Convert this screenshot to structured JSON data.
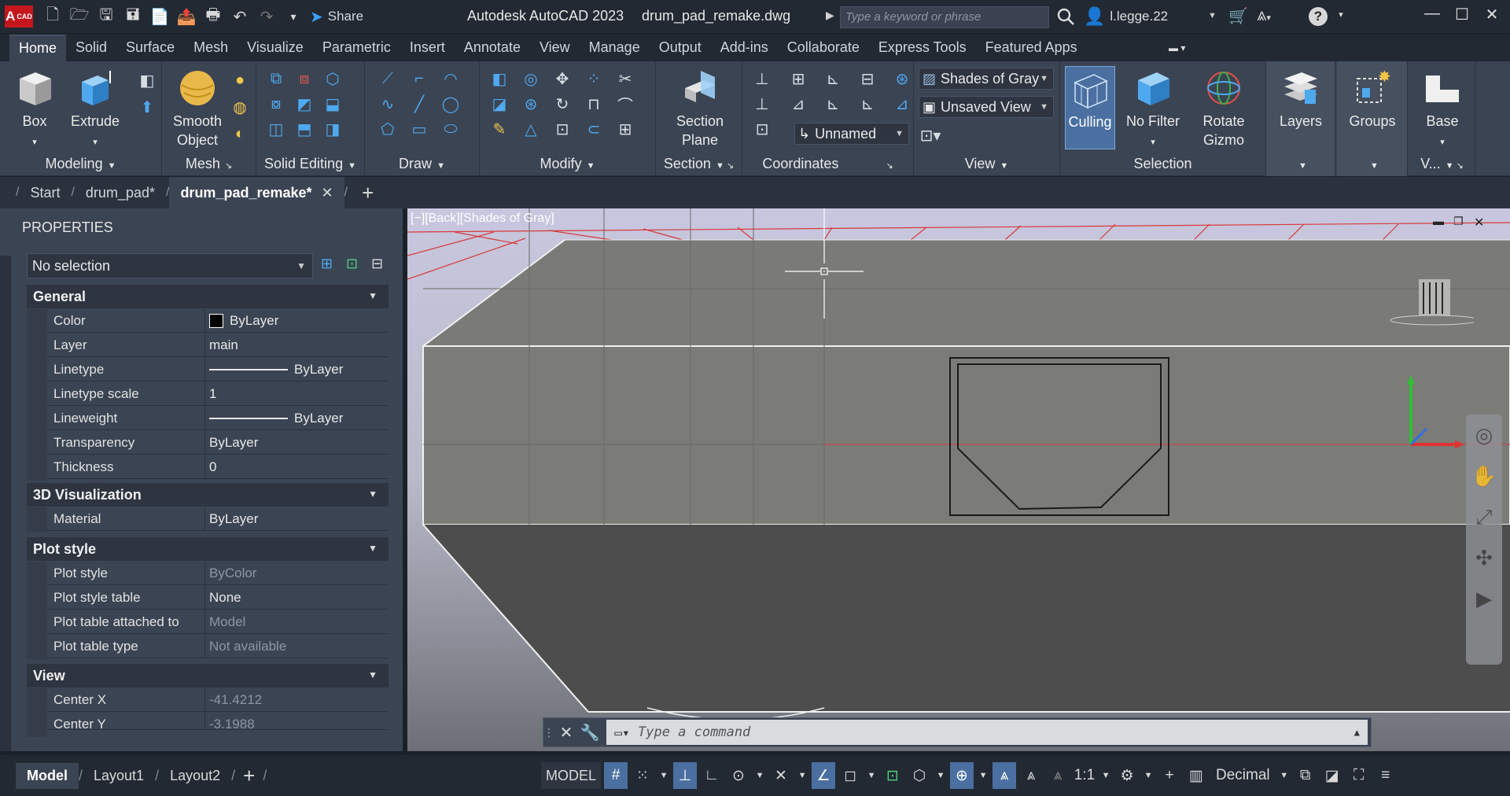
{
  "titlebar": {
    "app_logo": "A",
    "app_logo_sub": "CAD",
    "share_label": "Share",
    "app_title": "Autodesk AutoCAD 2023",
    "file_name": "drum_pad_remake.dwg",
    "search_placeholder": "Type a keyword or phrase",
    "user_name": "l.legge.22"
  },
  "ribbon_tabs": [
    "Home",
    "Solid",
    "Surface",
    "Mesh",
    "Visualize",
    "Parametric",
    "Insert",
    "Annotate",
    "View",
    "Manage",
    "Output",
    "Add-ins",
    "Collaborate",
    "Express Tools",
    "Featured Apps"
  ],
  "ribbon": {
    "modeling": {
      "label": "Modeling",
      "box": "Box",
      "extrude": "Extrude"
    },
    "mesh": {
      "label": "Mesh",
      "smooth_object_1": "Smooth",
      "smooth_object_2": "Object"
    },
    "solid_editing": {
      "label": "Solid Editing"
    },
    "draw": {
      "label": "Draw"
    },
    "modify": {
      "label": "Modify"
    },
    "section": {
      "label": "Section",
      "section_plane_1": "Section",
      "section_plane_2": "Plane"
    },
    "coordinates": {
      "label": "Coordinates",
      "ucs_name": "Unnamed"
    },
    "view": {
      "label": "View",
      "visual_style": "Shades of Gray",
      "saved_view": "Unsaved View"
    },
    "selection": {
      "label": "Selection",
      "culling": "Culling",
      "no_filter": "No Filter",
      "rotate_gizmo_1": "Rotate",
      "rotate_gizmo_2": "Gizmo"
    },
    "layers": {
      "label": "Layers"
    },
    "groups": {
      "label": "Groups"
    },
    "base": {
      "label": "Base",
      "group_label": "V..."
    }
  },
  "doc_tabs": {
    "start": "Start",
    "tab1": "drum_pad*",
    "tab2": "drum_pad_remake*"
  },
  "properties": {
    "title": "PROPERTIES",
    "selection": "No selection",
    "general": {
      "label": "General",
      "rows": [
        {
          "key": "Color",
          "value": "ByLayer"
        },
        {
          "key": "Layer",
          "value": "main"
        },
        {
          "key": "Linetype",
          "value": "ByLayer"
        },
        {
          "key": "Linetype scale",
          "value": "1"
        },
        {
          "key": "Lineweight",
          "value": "ByLayer"
        },
        {
          "key": "Transparency",
          "value": "ByLayer"
        },
        {
          "key": "Thickness",
          "value": "0"
        }
      ]
    },
    "visualization": {
      "label": "3D Visualization",
      "rows": [
        {
          "key": "Material",
          "value": "ByLayer"
        }
      ]
    },
    "plot_style": {
      "label": "Plot style",
      "rows": [
        {
          "key": "Plot style",
          "value": "ByColor"
        },
        {
          "key": "Plot style table",
          "value": "None"
        },
        {
          "key": "Plot table attached to",
          "value": "Model"
        },
        {
          "key": "Plot table type",
          "value": "Not available"
        }
      ]
    },
    "view": {
      "label": "View",
      "rows": [
        {
          "key": "Center X",
          "value": "-41.4212"
        },
        {
          "key": "Center Y",
          "value": "-3.1988"
        }
      ]
    }
  },
  "viewport": {
    "label": "[−][Back][Shades of Gray]"
  },
  "command_line": {
    "placeholder": "Type a command"
  },
  "statusbar": {
    "layout_tabs": [
      "Model",
      "Layout1",
      "Layout2"
    ],
    "model_label": "MODEL",
    "scale": "1:1",
    "units": "Decimal"
  },
  "colors": {
    "accent": "#4a6fa0",
    "ribbon_bg": "#3b4453",
    "titlebar_bg": "#222933",
    "viewport_bg": "#c9c8e0",
    "ucs_red": "#e03030",
    "ucs_green": "#30c030",
    "ucs_blue": "#3070e0"
  }
}
